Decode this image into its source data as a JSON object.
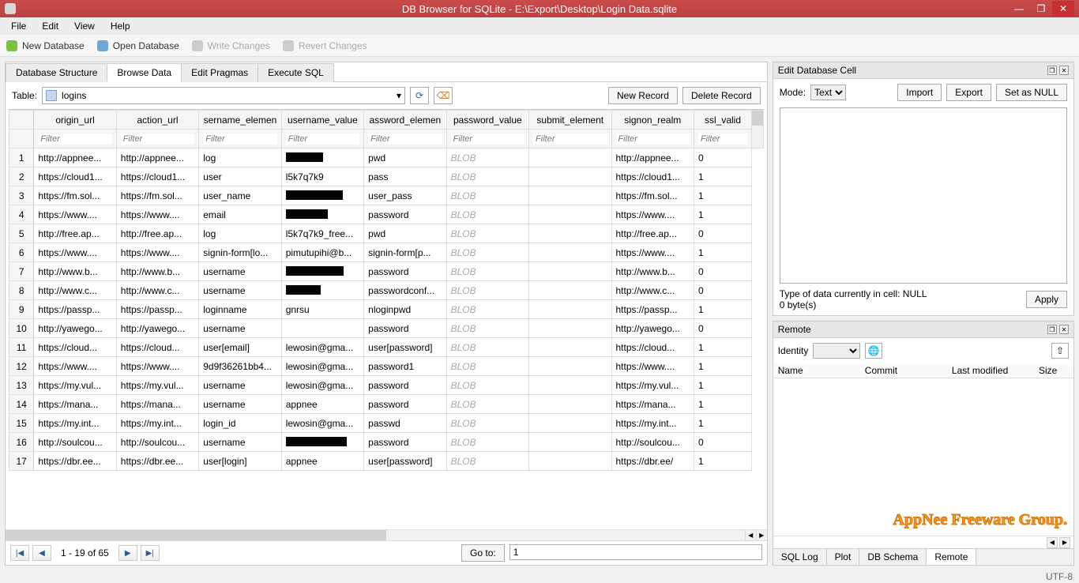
{
  "window": {
    "title": "DB Browser for SQLite - E:\\Export\\Desktop\\Login Data.sqlite"
  },
  "menu": [
    "File",
    "Edit",
    "View",
    "Help"
  ],
  "toolbar": {
    "new_db": "New Database",
    "open_db": "Open Database",
    "write_changes": "Write Changes",
    "revert_changes": "Revert Changes"
  },
  "main_tabs": {
    "structure": "Database Structure",
    "browse": "Browse Data",
    "pragmas": "Edit Pragmas",
    "sql": "Execute SQL"
  },
  "browse": {
    "table_label": "Table:",
    "table_selected": "logins",
    "new_record": "New Record",
    "delete_record": "Delete Record",
    "columns": [
      "origin_url",
      "action_url",
      "sername_elemen",
      "username_value",
      "assword_elemen",
      "password_value",
      "submit_element",
      "signon_realm",
      "ssl_valid"
    ],
    "filter_placeholder": "Filter",
    "goto_label": "Go to:",
    "goto_value": "1",
    "paging": "1 - 19 of 65",
    "rows": [
      {
        "n": 1,
        "origin": "http://appnee...",
        "action": "http://appnee...",
        "uel": "log",
        "uval": "[REDACTED]",
        "pel": "pwd",
        "pval": "BLOB",
        "sub": "",
        "realm": "http://appnee...",
        "ssl": "0"
      },
      {
        "n": 2,
        "origin": "https://cloud1...",
        "action": "https://cloud1...",
        "uel": "user",
        "uval": "l5k7q7k9",
        "pel": "pass",
        "pval": "BLOB",
        "sub": "",
        "realm": "https://cloud1...",
        "ssl": "1"
      },
      {
        "n": 3,
        "origin": "https://fm.sol...",
        "action": "https://fm.sol...",
        "uel": "user_name",
        "uval": "[REDACTED]",
        "pel": "user_pass",
        "pval": "BLOB",
        "sub": "",
        "realm": "https://fm.sol...",
        "ssl": "1"
      },
      {
        "n": 4,
        "origin": "https://www....",
        "action": "https://www....",
        "uel": "email",
        "uval": "[REDACTED]",
        "pel": "password",
        "pval": "BLOB",
        "sub": "",
        "realm": "https://www....",
        "ssl": "1"
      },
      {
        "n": 5,
        "origin": "http://free.ap...",
        "action": "http://free.ap...",
        "uel": "log",
        "uval": "l5k7q7k9_free...",
        "pel": "pwd",
        "pval": "BLOB",
        "sub": "",
        "realm": "http://free.ap...",
        "ssl": "0"
      },
      {
        "n": 6,
        "origin": "https://www....",
        "action": "https://www....",
        "uel": "signin-form[lo...",
        "uval": "pimutupihi@b...",
        "pel": "signin-form[p...",
        "pval": "BLOB",
        "sub": "",
        "realm": "https://www....",
        "ssl": "1"
      },
      {
        "n": 7,
        "origin": "http://www.b...",
        "action": "http://www.b...",
        "uel": "username",
        "uval": "[REDACTED]",
        "pel": "password",
        "pval": "BLOB",
        "sub": "",
        "realm": "http://www.b...",
        "ssl": "0"
      },
      {
        "n": 8,
        "origin": "http://www.c...",
        "action": "http://www.c...",
        "uel": "username",
        "uval": "[REDACTED]",
        "pel": "passwordconf...",
        "pval": "BLOB",
        "sub": "",
        "realm": "http://www.c...",
        "ssl": "0"
      },
      {
        "n": 9,
        "origin": "https://passp...",
        "action": "https://passp...",
        "uel": "loginname",
        "uval": "gnrsu",
        "pel": "nloginpwd",
        "pval": "BLOB",
        "sub": "",
        "realm": "https://passp...",
        "ssl": "1"
      },
      {
        "n": 10,
        "origin": "http://yawego...",
        "action": "http://yawego...",
        "uel": "username",
        "uval": "",
        "pel": "password",
        "pval": "BLOB",
        "sub": "",
        "realm": "http://yawego...",
        "ssl": "0"
      },
      {
        "n": 11,
        "origin": "https://cloud...",
        "action": "https://cloud...",
        "uel": "user[email]",
        "uval": "lewosin@gma...",
        "pel": "user[password]",
        "pval": "BLOB",
        "sub": "",
        "realm": "https://cloud...",
        "ssl": "1"
      },
      {
        "n": 12,
        "origin": "https://www....",
        "action": "https://www....",
        "uel": "9d9f36261bb4...",
        "uval": "lewosin@gma...",
        "pel": "password1",
        "pval": "BLOB",
        "sub": "",
        "realm": "https://www....",
        "ssl": "1"
      },
      {
        "n": 13,
        "origin": "https://my.vul...",
        "action": "https://my.vul...",
        "uel": "username",
        "uval": "lewosin@gma...",
        "pel": "password",
        "pval": "BLOB",
        "sub": "",
        "realm": "https://my.vul...",
        "ssl": "1"
      },
      {
        "n": 14,
        "origin": "https://mana...",
        "action": "https://mana...",
        "uel": "username",
        "uval": "appnee",
        "pel": "password",
        "pval": "BLOB",
        "sub": "",
        "realm": "https://mana...",
        "ssl": "1"
      },
      {
        "n": 15,
        "origin": "https://my.int...",
        "action": "https://my.int...",
        "uel": "login_id",
        "uval": "lewosin@gma...",
        "pel": "passwd",
        "pval": "BLOB",
        "sub": "",
        "realm": "https://my.int...",
        "ssl": "1"
      },
      {
        "n": 16,
        "origin": "http://soulcou...",
        "action": "http://soulcou...",
        "uel": "username",
        "uval": "[REDACTED]",
        "pel": "password",
        "pval": "BLOB",
        "sub": "",
        "realm": "http://soulcou...",
        "ssl": "0"
      },
      {
        "n": 17,
        "origin": "https://dbr.ee...",
        "action": "https://dbr.ee...",
        "uel": "user[login]",
        "uval": "appnee",
        "pel": "user[password]",
        "pval": "BLOB",
        "sub": "",
        "realm": "https://dbr.ee/",
        "ssl": "1"
      }
    ]
  },
  "edit_cell": {
    "title": "Edit Database Cell",
    "mode_label": "Mode:",
    "mode_value": "Text",
    "import": "Import",
    "export": "Export",
    "set_null": "Set as NULL",
    "type_info": "Type of data currently in cell: NULL",
    "bytes": "0 byte(s)",
    "apply": "Apply"
  },
  "remote": {
    "title": "Remote",
    "identity_label": "Identity",
    "columns": [
      "Name",
      "Commit",
      "Last modified",
      "Size"
    ]
  },
  "bottom_tabs": {
    "sql_log": "SQL Log",
    "plot": "Plot",
    "db_schema": "DB Schema",
    "remote": "Remote"
  },
  "watermark": "AppNee Freeware Group.",
  "status": "UTF-8"
}
